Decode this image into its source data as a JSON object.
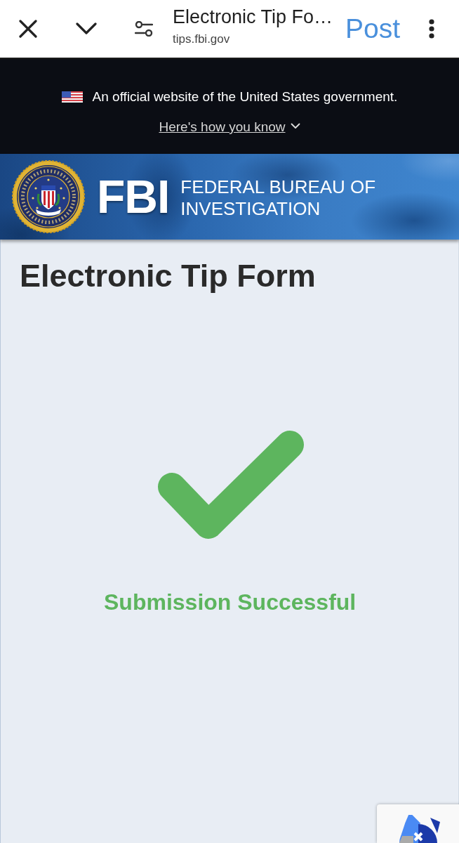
{
  "browser_bar": {
    "title": "Electronic Tip Fo…",
    "url": "tips.fbi.gov",
    "action": "Post"
  },
  "gov_banner": {
    "text": "An official website of the United States government.",
    "link": "Here's how you know"
  },
  "header": {
    "wordmark": "FBI",
    "name_lines": [
      "FEDERAL BUREAU OF",
      "INVESTIGATION"
    ]
  },
  "page": {
    "title": "Electronic Tip Form",
    "status": {
      "kind": "success",
      "message": "Submission Successful"
    }
  }
}
